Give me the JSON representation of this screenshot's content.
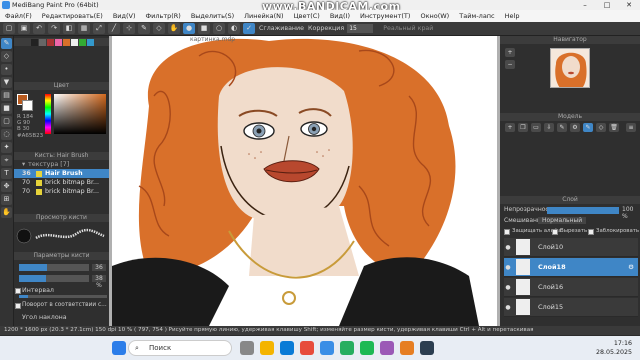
{
  "window": {
    "title": "MediBang Paint Pro (64bit)",
    "controls": [
      "–",
      "□",
      "✕"
    ]
  },
  "watermark": "www.BANDICAM.com",
  "menu": [
    "Файл(F)",
    "Редактировать(E)",
    "Вид(V)",
    "Фильтр(R)",
    "Выделить(S)",
    "Линейка(N)",
    "Цвет(C)",
    "Вид(I)",
    "Инструмент(T)",
    "Окно(W)",
    "Тайм-лапс",
    "Help"
  ],
  "toolbar": {
    "smoothing_label": "Сглаживание",
    "correction_label": "Коррекция",
    "correction_value": "15",
    "last_label": "Реальный край"
  },
  "canvas": {
    "filename": "картинка.mdp"
  },
  "left": {
    "color_header": "Цвет",
    "color_values": {
      "r": "R 184",
      "g": "G 90",
      "b": "B 30"
    },
    "hex": "#A65B23",
    "brush_header": "Кисть: Hair Brush",
    "brush_group": "текстура [7]",
    "brushes": [
      {
        "size": "36",
        "name": "Hair Brush"
      },
      {
        "size": "70",
        "name": "brick bitmap Br..."
      },
      {
        "size": "70",
        "name": "brick bitmap Br..."
      }
    ],
    "preview_header": "Просмотр кисти",
    "params_header": "Параметры кисти",
    "size_value": "36",
    "opacity_value": "38 %",
    "interval_label": "Интервал",
    "rotate_label": "Поворот в соответствии с...",
    "angle_label": "Угол наклона"
  },
  "right": {
    "navigator_header": "Навигатор",
    "brush_header": "Модель",
    "layer_header": "Слой",
    "opacity_label": "Непрозрачность",
    "opacity_value": "100 %",
    "blend_label": "Смешивание",
    "blend_value": "Нормальный",
    "protect_label": "Защищать альфа",
    "clip_label": "Вырезать",
    "lock_label": "Заблокировать",
    "layers": [
      {
        "name": "Слой10"
      },
      {
        "name": "Слой18"
      },
      {
        "name": "Слой16"
      },
      {
        "name": "Слой15"
      }
    ]
  },
  "status": "1200 * 1600 px  (20.3 * 27.1cm)  150 dpi  10 %  ( 797, 754 )  Рисуйте прямую линию, удерживая клавишу Shift; изменяйте размер кисти, удерживая клавиши Ctrl + Alt и перетаскивая",
  "taskbar": {
    "search_placeholder": "Поиск",
    "time": "17:16",
    "date": "28.05.2025"
  },
  "colors": {
    "accent": "#3f86c6",
    "hair": "#d9702a",
    "lips": "#b8482e",
    "dark": "#1a1a1a"
  }
}
